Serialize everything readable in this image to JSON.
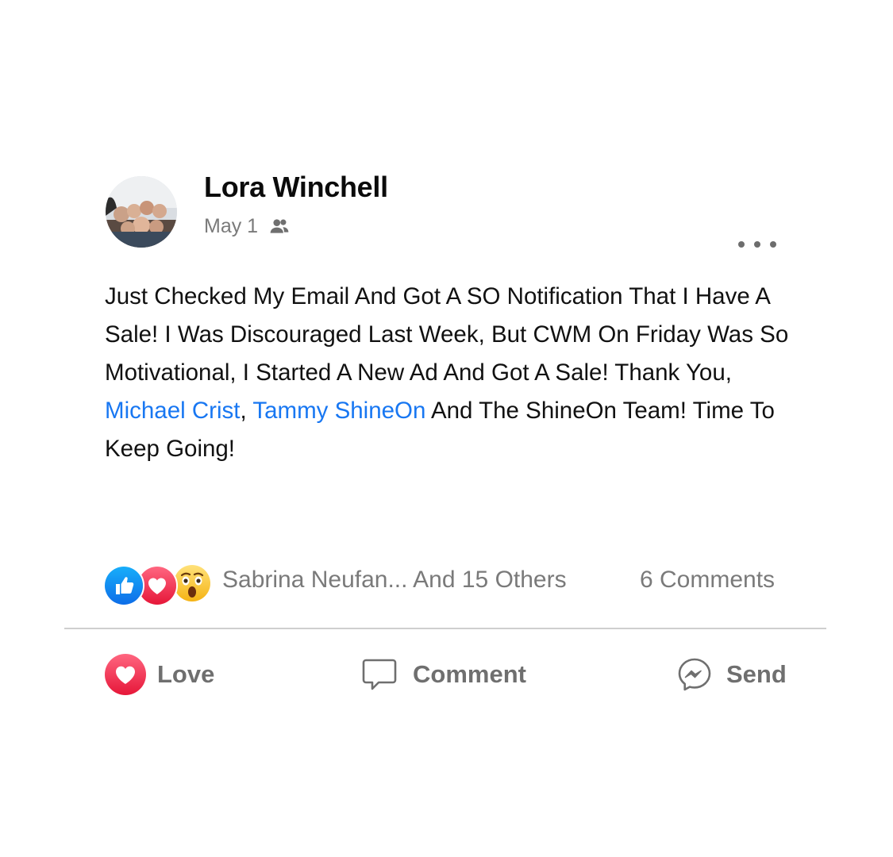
{
  "post": {
    "author": "Lora Winchell",
    "date": "May 1",
    "privacy_icon": "friends-icon",
    "more_icon": "ellipsis-icon",
    "text": [
      {
        "type": "text",
        "value": "Just Checked My Email And Got A SO Notification That I Have A Sale! I Was Discouraged Last Week, But CWM On Friday Was So Motivational, I Started A New Ad And Got A Sale! Thank You, "
      },
      {
        "type": "mention",
        "value": "Michael Crist"
      },
      {
        "type": "text",
        "value": ", "
      },
      {
        "type": "mention",
        "value": "Tammy ShineOn"
      },
      {
        "type": "text",
        "value": " And The ShineOn Team! Time To Keep Going!"
      }
    ]
  },
  "reactions": {
    "icons": [
      "like-icon",
      "love-icon",
      "wow-icon"
    ],
    "summary": "Sabrina Neufan... And 15 Others",
    "comments": "6 Comments"
  },
  "actions": {
    "love": "Love",
    "comment": "Comment",
    "send": "Send"
  },
  "colors": {
    "mention": "#1877f2",
    "like": "#2d88ff",
    "love": "#f33e58",
    "muted_text": "#7a7a7a"
  }
}
